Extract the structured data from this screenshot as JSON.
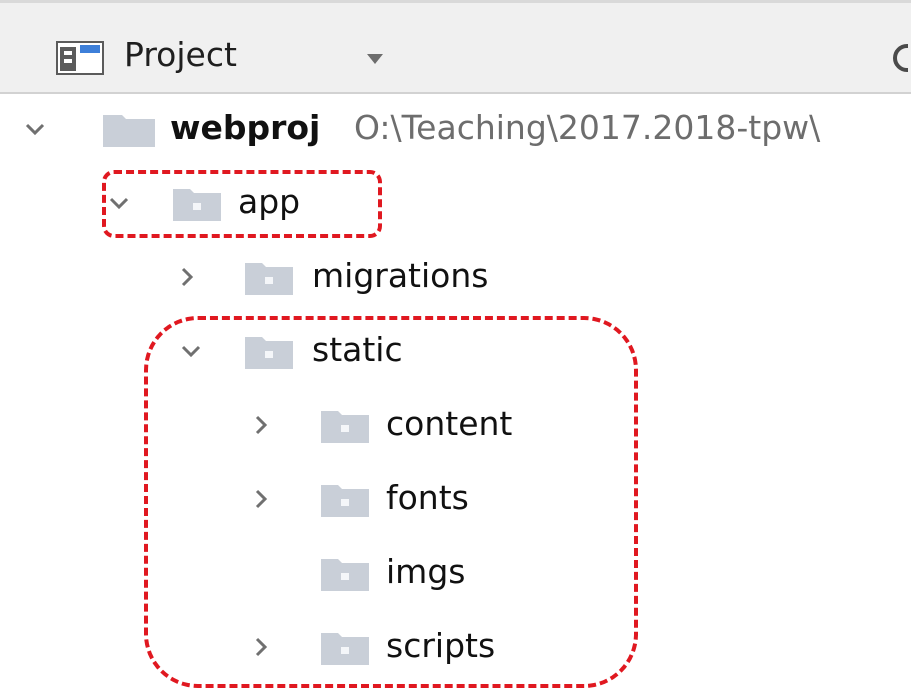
{
  "panel": {
    "title": "Project",
    "icon": "project-panel-icon",
    "dropdown_icon": "triangle-down-icon"
  },
  "tree": {
    "root": {
      "label": "webproj",
      "path": "O:\\Teaching\\2017.2018-tpw\\",
      "expanded": true
    },
    "items": [
      {
        "label": "app",
        "expanded": true,
        "has_children": true
      },
      {
        "label": "migrations",
        "expanded": false,
        "has_children": true
      },
      {
        "label": "static",
        "expanded": true,
        "has_children": true
      },
      {
        "label": "content",
        "expanded": false,
        "has_children": true
      },
      {
        "label": "fonts",
        "expanded": false,
        "has_children": true
      },
      {
        "label": "imgs",
        "expanded": false,
        "has_children": false
      },
      {
        "label": "scripts",
        "expanded": false,
        "has_children": true
      }
    ]
  },
  "colors": {
    "highlight": "#e01820",
    "folder": "#c9cfd8",
    "header_bg": "#f0f0f0"
  }
}
